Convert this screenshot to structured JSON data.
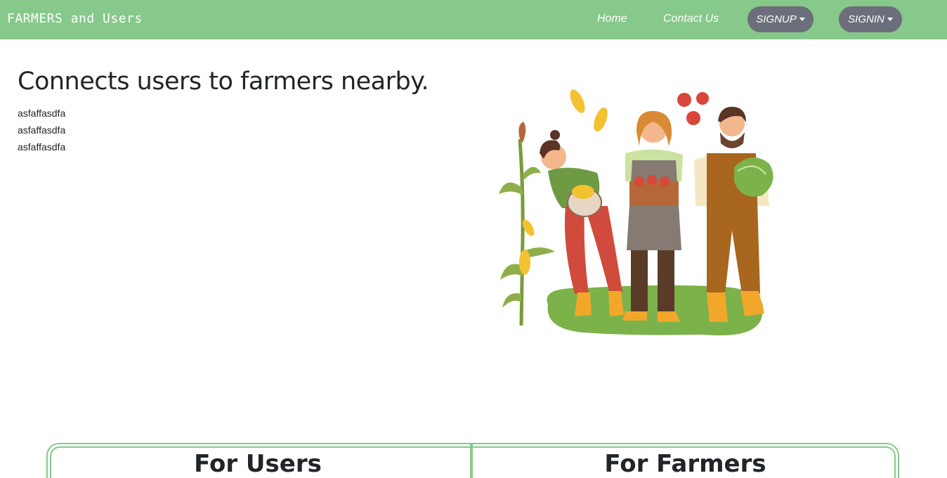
{
  "navbar": {
    "brand": "FARMERS and Users",
    "home": "Home",
    "contact": "Contact Us",
    "signup": "SIGNUP",
    "signin": "SIGNIN",
    "color": "#86c98a",
    "pill_color": "#6c6f7b"
  },
  "hero": {
    "title": "Connects users to farmers nearby.",
    "lines": [
      "asfaffasdfa",
      "asfaffasdfa",
      "asfaffasdfa"
    ]
  },
  "cards": {
    "users_title": "For Users",
    "farmers_title": "For Farmers"
  }
}
